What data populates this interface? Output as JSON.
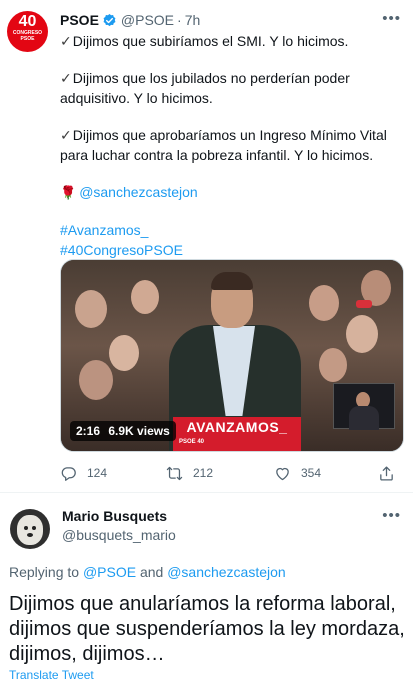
{
  "tweet1": {
    "author": {
      "name": "PSOE",
      "handle": "@PSOE",
      "time": "7h",
      "verified": true,
      "avatar": {
        "number": "40",
        "text": "CONGRESO",
        "logo": "PSOE"
      }
    },
    "body": {
      "line1": "Dijimos que subiríamos el SMI. Y lo hicimos.",
      "line2a": "Dijimos que los jubilados no perderían poder",
      "line2b": "adquisitivo. Y lo hicimos.",
      "line3a": "Dijimos que aprobaríamos un Ingreso Mínimo Vital",
      "line3b": "para luchar contra la pobreza infantil. Y lo hicimos.",
      "mention": "@sanchezcastejon",
      "hashtag1": "#Avanzamos_",
      "hashtag2": "#40CongresoPSOE"
    },
    "video": {
      "duration": "2:16",
      "views": "6.9K views",
      "podium_text": "AVANZAMOS_",
      "podium_sub": "PSOE 40"
    },
    "actions": {
      "replies": "124",
      "retweets": "212",
      "likes": "354"
    }
  },
  "tweet2": {
    "author": {
      "name": "Mario Busquets",
      "handle": "@busquets_mario"
    },
    "reply_prefix": "Replying to",
    "reply_to_1": "@PSOE",
    "reply_and": "and",
    "reply_to_2": "@sanchezcastejon",
    "body": "Dijimos que anularíamos la reforma laboral, dijimos que suspenderíamos la ley mordaza, dijimos, dijimos…",
    "translate": "Translate Tweet"
  },
  "colors": {
    "link": "#1d9bf0",
    "muted": "#536471",
    "psoe_red": "#e30613"
  }
}
